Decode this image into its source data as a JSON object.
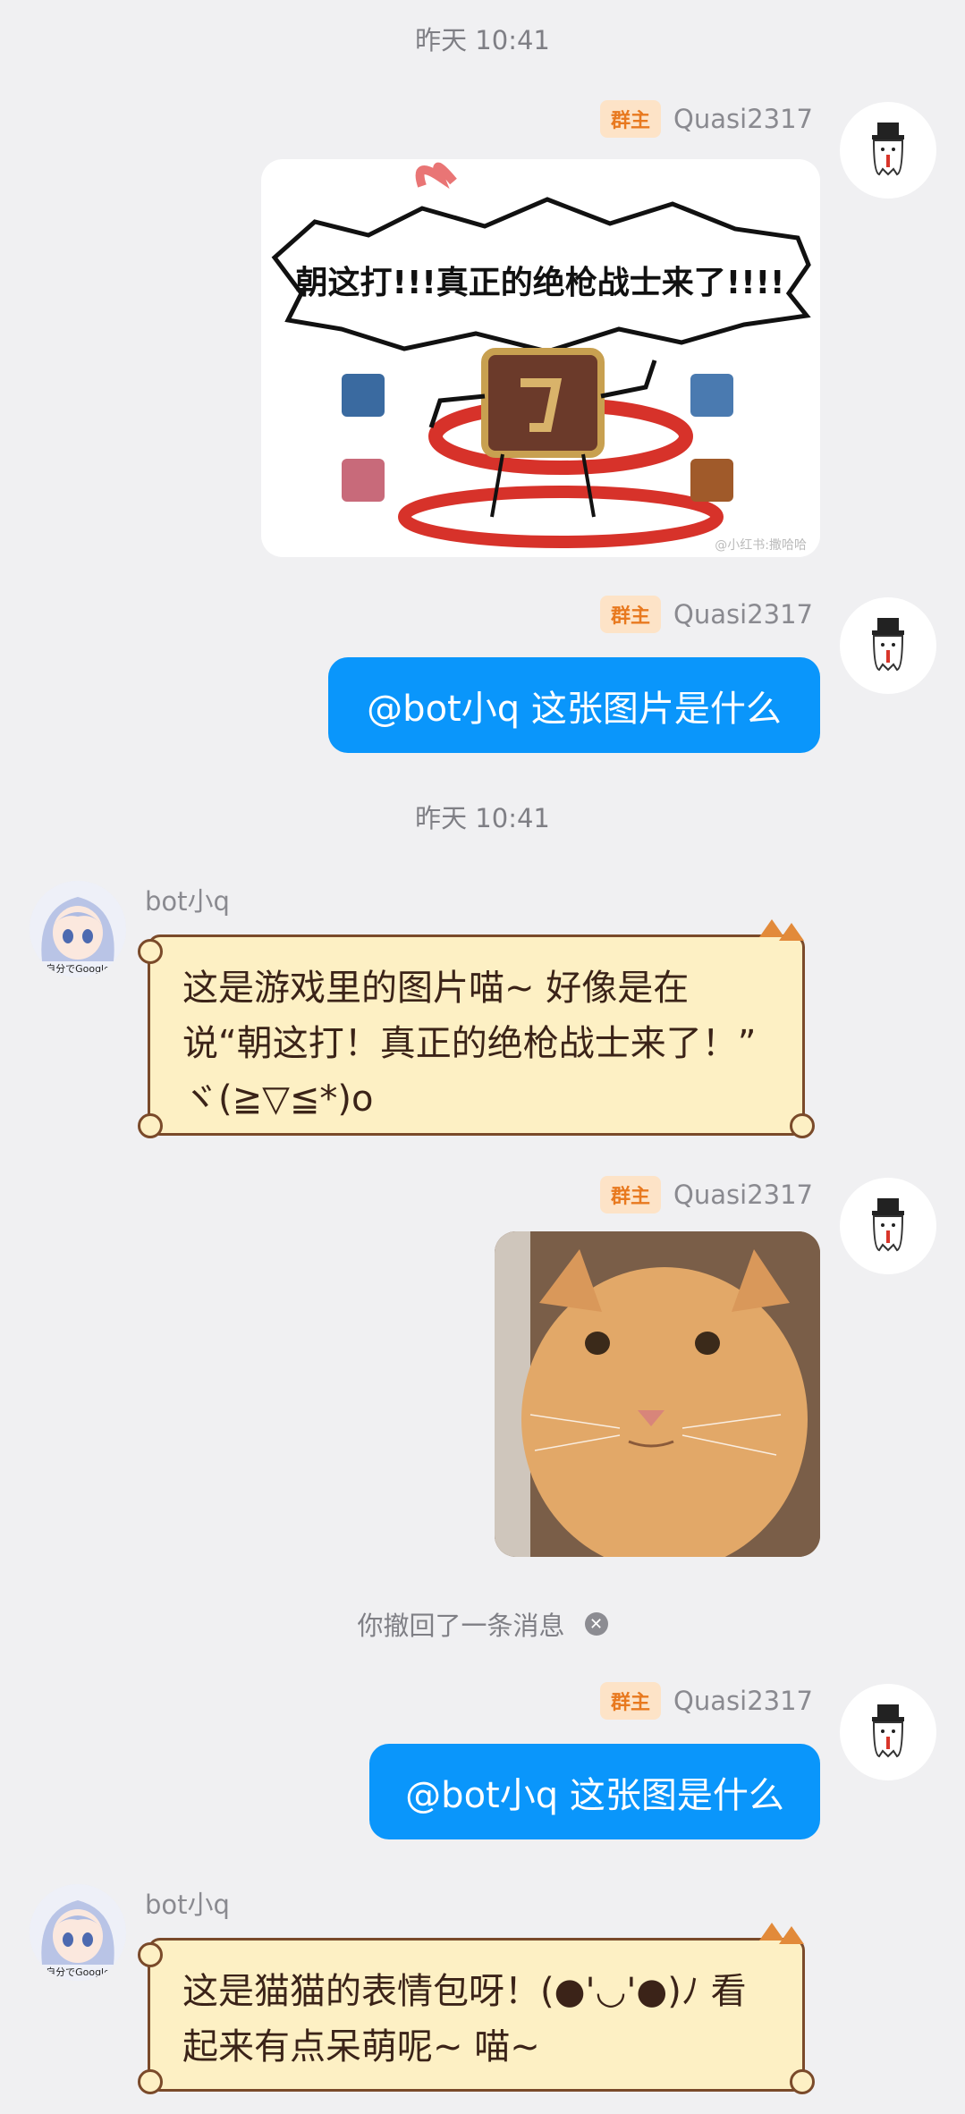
{
  "messages": {
    "ts1": "昨天 10:41",
    "ts2": "昨天 10:41",
    "owner_badge": "群主",
    "user_name": "Quasi2317",
    "bot_name": "bot小q",
    "meme_text": "朝这打!!!真正的绝枪战士来了!!!!",
    "meme_watermark": "@小红书:撒哈哈",
    "q1": "@bot小q 这张图片是什么",
    "a1": "这是游戏里的图片喵~ 好像是在说“朝这打！真正的绝枪战士来了！” ヾ(≧▽≦*)o",
    "recall": "你撤回了一条消息",
    "q2": "@bot小q 这张图是什么",
    "a2": "这是猫猫的表情包呀！(●'◡'●)ﾉ 看起来有点呆萌呢~ 喵~",
    "bot_avatar_caption": "自分でGoogle"
  },
  "colors": {
    "background": "#f0f0f2",
    "blue_bubble": "#0a96fb",
    "owner_badge_bg": "#fde3c7",
    "owner_badge_fg": "#e8791f",
    "cat_bubble_bg": "#fdf0c4",
    "cat_bubble_border": "#7a4a2a"
  },
  "icons": {
    "user_avatar": "top-hat-ghost-icon",
    "bot_avatar": "anime-girl-avatar",
    "recall_close": "close-icon"
  }
}
